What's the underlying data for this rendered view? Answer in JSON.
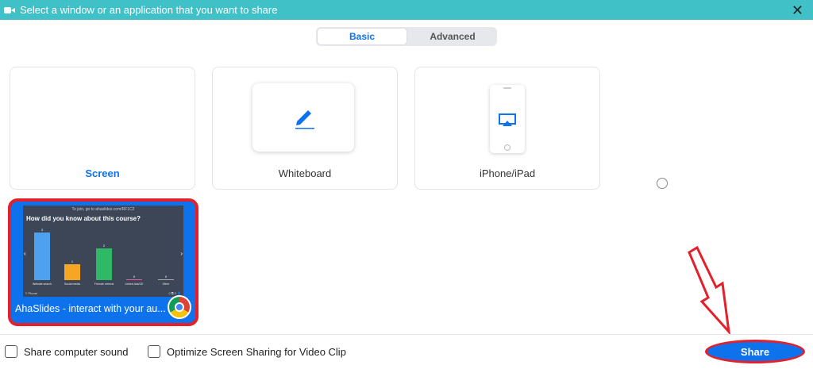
{
  "window": {
    "title": "Select a window or an application that you want to share",
    "close_glyph": "✕"
  },
  "tabs": [
    {
      "label": "Basic",
      "active": true
    },
    {
      "label": "Advanced",
      "active": false
    }
  ],
  "cards": {
    "screen": "Screen",
    "whiteboard": "Whiteboard",
    "iphone": "iPhone/iPad"
  },
  "app_window": {
    "caption": "AhaSlides - interact with your au...",
    "thumbnail": {
      "url_text": "To join, go to ahaslides.com/RF1C2",
      "question": "How did you know about this course?",
      "bars": [
        {
          "value": "3",
          "label": "Website search",
          "color": "#4ea1ee"
        },
        {
          "value": "1",
          "label": "Social media",
          "color": "#f5a623"
        },
        {
          "value": "2",
          "label": "Friends' referral",
          "color": "#2fb866"
        },
        {
          "value": "0",
          "label": "Linked Ads/CE",
          "color": "#e85a9b"
        },
        {
          "value": "0",
          "label": "Other",
          "color": "#aaaaaa"
        }
      ],
      "footer_left": "≡ Phone",
      "footer_right": "0 ⧉ 0 👤"
    }
  },
  "footer": {
    "share_sound": "Share computer sound",
    "optimize": "Optimize Screen Sharing for Video Clip",
    "share_button": "Share"
  },
  "colors": {
    "titlebar": "#40c1c8",
    "accent": "#0e72ed",
    "highlight_red": "#e3202b"
  }
}
